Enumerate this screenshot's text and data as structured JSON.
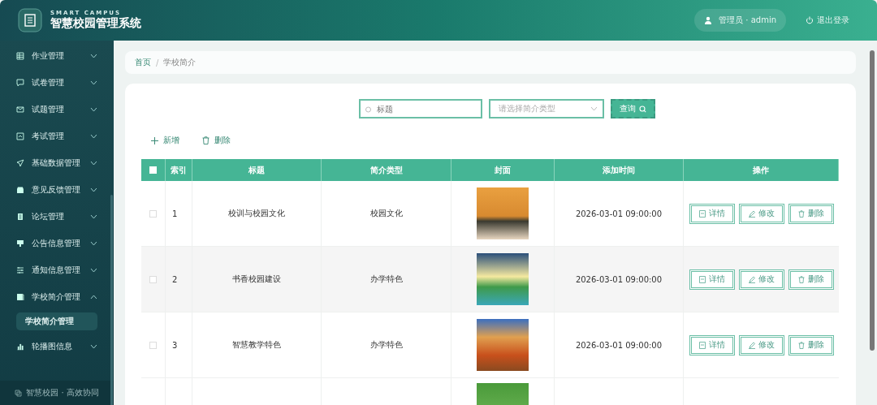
{
  "header": {
    "subtitle": "SMART CAMPUS",
    "title": "智慧校园管理系统",
    "user": "管理员 · admin",
    "logout": "退出登录"
  },
  "sidebar": {
    "items": [
      {
        "label": "作业管理",
        "expanded": false
      },
      {
        "label": "试卷管理",
        "expanded": false
      },
      {
        "label": "试题管理",
        "expanded": false
      },
      {
        "label": "考试管理",
        "expanded": false
      },
      {
        "label": "基础数据管理",
        "expanded": false
      },
      {
        "label": "意见反馈管理",
        "expanded": false
      },
      {
        "label": "论坛管理",
        "expanded": false
      },
      {
        "label": "公告信息管理",
        "expanded": false
      },
      {
        "label": "通知信息管理",
        "expanded": false
      },
      {
        "label": "学校简介管理",
        "expanded": true,
        "children": [
          {
            "label": "学校简介管理",
            "selected": true
          }
        ]
      },
      {
        "label": "轮播图信息",
        "expanded": false
      }
    ],
    "footer": "智慧校园 · 高效协同"
  },
  "breadcrumb": {
    "items": [
      "首页",
      "学校简介"
    ],
    "separator": "/"
  },
  "search": {
    "placeholder": "标题",
    "select_placeholder": "请选择简介类型",
    "button": "查询"
  },
  "actions": {
    "add": "新增",
    "delete": "删除"
  },
  "table": {
    "columns": [
      "索引",
      "标题",
      "简介类型",
      "封面",
      "添加时间",
      "操作"
    ],
    "all_checked": false,
    "rows": [
      {
        "index": "1",
        "title": "校训与校园文化",
        "type": "校园文化",
        "time": "2026-03-01 09:00:00",
        "checked": false,
        "buttons": [
          "详情",
          "修改",
          "删除"
        ]
      },
      {
        "index": "2",
        "title": "书香校园建设",
        "type": "办学特色",
        "time": "2026-03-01 09:00:00",
        "checked": false,
        "buttons": [
          "详情",
          "修改",
          "删除"
        ]
      },
      {
        "index": "3",
        "title": "智慧教学特色",
        "type": "办学特色",
        "time": "2026-03-01 09:00:00",
        "checked": false,
        "buttons": [
          "详情",
          "修改",
          "删除"
        ]
      }
    ],
    "more_rows_below": true
  }
}
